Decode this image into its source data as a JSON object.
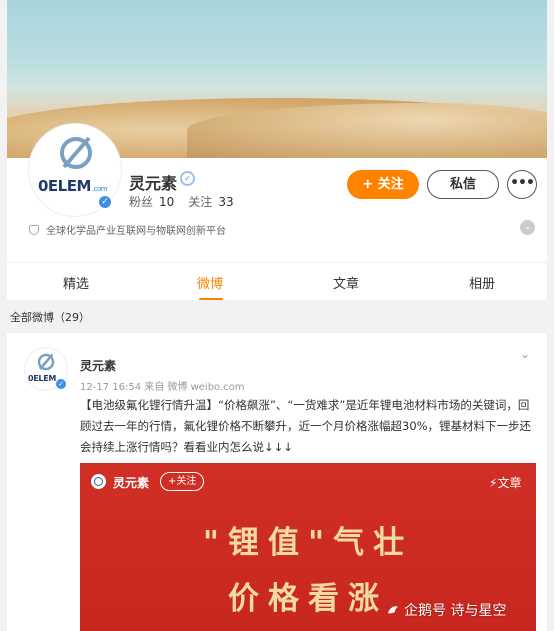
{
  "profile": {
    "name": "灵元素",
    "logo_text": "0ELEM",
    "logo_small": ".com",
    "fans_label": "粉丝",
    "fans_count": "10",
    "following_label": "关注",
    "following_count": "33",
    "follow_button": "+ 关注",
    "message_button": "私信",
    "more_button": "•••",
    "intro": "全球化学品产业互联网与物联网创新平台"
  },
  "tabs": [
    {
      "label": "精选",
      "active": false
    },
    {
      "label": "微博",
      "active": true
    },
    {
      "label": "文章",
      "active": false
    },
    {
      "label": "相册",
      "active": false
    }
  ],
  "all_posts_label": "全部微博（29）",
  "post": {
    "author": "灵元素",
    "meta": "12-17 16:54 来自 微博 weibo.com",
    "text": "【电池级氟化锂行情升温】“价格飙涨”、“一货难求”是近年锂电池材料市场的关键词，回顾过去一年的行情，氟化锂价格不断攀升，近一个月价格涨幅超30%，锂基材料下一步还会持续上涨行情吗？看看业内怎么说↓↓↓",
    "card": {
      "author": "灵元素",
      "follow": "+关注",
      "article_label": "文章",
      "headline_1": "\"锂值\"气壮",
      "headline_2": "价格看涨"
    }
  },
  "watermark": "企鹅号 诗与星空",
  "colors": {
    "accent": "#ff8200",
    "verify_blue": "#3e8ee6",
    "card_red": "#cc2b22",
    "card_text": "#f3d9a3"
  }
}
